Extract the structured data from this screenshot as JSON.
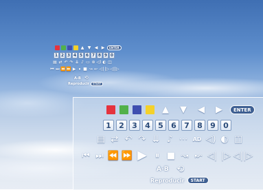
{
  "small_panel": {
    "colors": [
      "#e5333e",
      "#52b14a",
      "#3f4fb0",
      "#f4d12b"
    ],
    "nav_icons": [
      "▲",
      "▼",
      "◀",
      "▶"
    ],
    "enter_label": "ENTER",
    "numbers": [
      "1",
      "2",
      "3",
      "4",
      "5",
      "6",
      "7",
      "8",
      "9",
      "0"
    ],
    "icons_row3": [
      "▤",
      "⇄",
      "↶",
      "↷",
      "⇊",
      "♪",
      "▭",
      "⊛",
      "◁)",
      "◐",
      "◫"
    ],
    "icons_row4": [
      "⏮",
      "⏭",
      "⏪",
      "⏩",
      "▶",
      "⏸",
      "■",
      "↝",
      "↜",
      "◁|",
      "|▷",
      "◁||▷"
    ],
    "ab_label": "A-B",
    "reproducir_label": "Reproducir",
    "start_label": "START"
  },
  "big_panel": {
    "colors": [
      "#e5333e",
      "#52b14a",
      "#3f4fb0",
      "#f4d12b"
    ],
    "nav_icons": [
      "▲",
      "▼",
      "◀",
      "▶"
    ],
    "enter_label": "ENTER",
    "numbers": [
      "1",
      "2",
      "3",
      "4",
      "5",
      "6",
      "7",
      "8",
      "9",
      "0"
    ],
    "icons_row3": [
      "▤",
      "⇄",
      "↶",
      "↷",
      "⇊",
      "♪",
      "⋯",
      "AD",
      "◁)",
      "◐",
      "◫"
    ],
    "icons_row4": [
      "⏮",
      "⏭",
      "⏪",
      "⏩",
      "▶",
      "⏸",
      "■",
      "↝",
      "↜",
      "◁|",
      "|▷",
      "◁||▷"
    ],
    "ab_label": "A-B",
    "reproducir_label": "Reproducir",
    "start_label": "START"
  }
}
